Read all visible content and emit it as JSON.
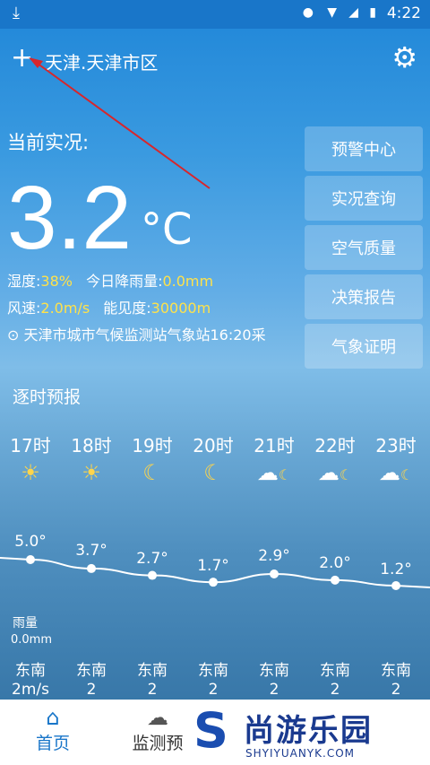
{
  "status_bar": {
    "time": "4:22"
  },
  "header": {
    "city": "天津.天津市区"
  },
  "current": {
    "label": "当前实况:",
    "temperature": "3.2",
    "unit": "°C",
    "humidity_label": "湿度:",
    "humidity": "38%",
    "rain_label": "今日降雨量:",
    "rain": "0.0mm",
    "wind_label": "风速:",
    "wind": "2.0m/s",
    "visibility_label": "能见度:",
    "visibility": "30000m",
    "station": "天津市城市气候监测站气象站16:20采"
  },
  "side_buttons": [
    "预警中心",
    "实况查询",
    "空气质量",
    "决策报告",
    "气象证明"
  ],
  "hourly": {
    "title": "逐时预报",
    "rain_label": "雨量",
    "rain_value": "0.0mm",
    "items": [
      {
        "hour": "17时",
        "icon": "sun-icon",
        "temp": "5.0°",
        "dir": "东南",
        "speed": "2m/s"
      },
      {
        "hour": "18时",
        "icon": "sun-icon",
        "temp": "3.7°",
        "dir": "东南",
        "speed": "2"
      },
      {
        "hour": "19时",
        "icon": "moon-icon",
        "temp": "2.7°",
        "dir": "东南",
        "speed": "2"
      },
      {
        "hour": "20时",
        "icon": "moon-icon",
        "temp": "1.7°",
        "dir": "东南",
        "speed": "2"
      },
      {
        "hour": "21时",
        "icon": "cloud-moon-icon",
        "temp": "2.9°",
        "dir": "东南",
        "speed": "2"
      },
      {
        "hour": "22时",
        "icon": "cloud-moon-icon",
        "temp": "2.0°",
        "dir": "东南",
        "speed": "2"
      },
      {
        "hour": "23时",
        "icon": "cloud-moon-icon",
        "temp": "1.2°",
        "dir": "东南",
        "speed": "2"
      }
    ]
  },
  "tabs": {
    "home": "首页",
    "monitor": "监测预"
  },
  "watermark": {
    "logo": "S",
    "cn": "尚游乐园",
    "en": "SHYIYUANYK.COM"
  },
  "colors": {
    "accent": "#1976c9",
    "highlight": "#ffe24a"
  }
}
